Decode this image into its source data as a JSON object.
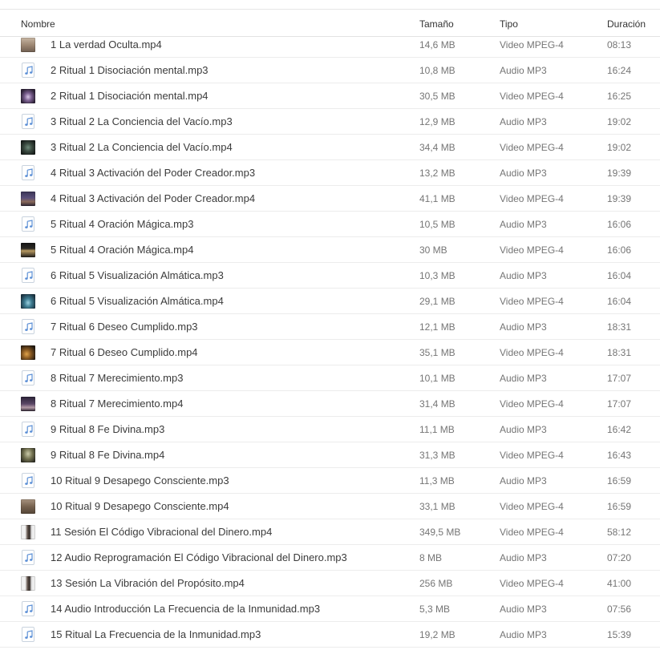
{
  "columns": {
    "name": "Nombre",
    "size": "Tamaño",
    "type": "Tipo",
    "duration": "Duración"
  },
  "files": [
    {
      "name": "1 La verdad Oculta.mp4",
      "size": "14,6 MB",
      "type": "Video MPEG-4",
      "duration": "08:13",
      "icon": "video-thumbnail-icon"
    },
    {
      "name": "2 Ritual 1 Disociación mental.mp3",
      "size": "10,8 MB",
      "type": "Audio MP3",
      "duration": "16:24",
      "icon": "audio-file-icon"
    },
    {
      "name": "2 Ritual 1 Disociación mental.mp4",
      "size": "30,5 MB",
      "type": "Video MPEG-4",
      "duration": "16:25",
      "icon": "video-thumbnail-icon"
    },
    {
      "name": "3 Ritual 2 La Conciencia del Vacío.mp3",
      "size": "12,9 MB",
      "type": "Audio MP3",
      "duration": "19:02",
      "icon": "audio-file-icon"
    },
    {
      "name": "3 Ritual 2 La Conciencia del Vacío.mp4",
      "size": "34,4 MB",
      "type": "Video MPEG-4",
      "duration": "19:02",
      "icon": "video-thumbnail-icon"
    },
    {
      "name": "4 Ritual 3 Activación del Poder Creador.mp3",
      "size": "13,2 MB",
      "type": "Audio MP3",
      "duration": "19:39",
      "icon": "audio-file-icon"
    },
    {
      "name": "4 Ritual 3 Activación del Poder Creador.mp4",
      "size": "41,1 MB",
      "type": "Video MPEG-4",
      "duration": "19:39",
      "icon": "video-thumbnail-icon"
    },
    {
      "name": "5 Ritual 4 Oración Mágica.mp3",
      "size": "10,5 MB",
      "type": "Audio MP3",
      "duration": "16:06",
      "icon": "audio-file-icon"
    },
    {
      "name": "5 Ritual 4 Oración Mágica.mp4",
      "size": "30 MB",
      "type": "Video MPEG-4",
      "duration": "16:06",
      "icon": "video-thumbnail-icon"
    },
    {
      "name": "6 Ritual 5 Visualización Almática.mp3",
      "size": "10,3 MB",
      "type": "Audio MP3",
      "duration": "16:04",
      "icon": "audio-file-icon"
    },
    {
      "name": "6 Ritual 5 Visualización Almática.mp4",
      "size": "29,1 MB",
      "type": "Video MPEG-4",
      "duration": "16:04",
      "icon": "video-thumbnail-icon"
    },
    {
      "name": "7 Ritual 6 Deseo Cumplido.mp3",
      "size": "12,1 MB",
      "type": "Audio MP3",
      "duration": "18:31",
      "icon": "audio-file-icon"
    },
    {
      "name": "7 Ritual 6 Deseo Cumplido.mp4",
      "size": "35,1 MB",
      "type": "Video MPEG-4",
      "duration": "18:31",
      "icon": "video-thumbnail-icon"
    },
    {
      "name": "8 Ritual 7 Merecimiento.mp3",
      "size": "10,1 MB",
      "type": "Audio MP3",
      "duration": "17:07",
      "icon": "audio-file-icon"
    },
    {
      "name": "8 Ritual 7 Merecimiento.mp4",
      "size": "31,4 MB",
      "type": "Video MPEG-4",
      "duration": "17:07",
      "icon": "video-thumbnail-icon"
    },
    {
      "name": "9 Ritual 8 Fe Divina.mp3",
      "size": "11,1 MB",
      "type": "Audio MP3",
      "duration": "16:42",
      "icon": "audio-file-icon"
    },
    {
      "name": "9 Ritual 8 Fe Divina.mp4",
      "size": "31,3 MB",
      "type": "Video MPEG-4",
      "duration": "16:43",
      "icon": "video-thumbnail-icon"
    },
    {
      "name": "10 Ritual 9 Desapego Consciente.mp3",
      "size": "11,3 MB",
      "type": "Audio MP3",
      "duration": "16:59",
      "icon": "audio-file-icon"
    },
    {
      "name": "10 Ritual 9 Desapego Consciente.mp4",
      "size": "33,1 MB",
      "type": "Video MPEG-4",
      "duration": "16:59",
      "icon": "video-thumbnail-icon"
    },
    {
      "name": "11 Sesión El Código Vibracional del Dinero.mp4",
      "size": "349,5 MB",
      "type": "Video MPEG-4",
      "duration": "58:12",
      "icon": "person-thumbnail-icon"
    },
    {
      "name": "12 Audio Reprogramación El Código Vibracional del Dinero.mp3",
      "size": "8 MB",
      "type": "Audio MP3",
      "duration": "07:20",
      "icon": "audio-file-icon"
    },
    {
      "name": "13 Sesión La Vibración del Propósito.mp4",
      "size": "256 MB",
      "type": "Video MPEG-4",
      "duration": "41:00",
      "icon": "person-thumbnail-icon"
    },
    {
      "name": "14 Audio Introducción La Frecuencia de la Inmunidad.mp3",
      "size": "5,3 MB",
      "type": "Audio MP3",
      "duration": "07:56",
      "icon": "audio-file-icon"
    },
    {
      "name": "15 Ritual La Frecuencia de la Inmunidad.mp3",
      "size": "19,2 MB",
      "type": "Audio MP3",
      "duration": "15:39",
      "icon": "audio-file-icon"
    }
  ],
  "colors": {
    "audio_icon": "#5b8fd6",
    "header_border": "#e3e3e3",
    "row_border": "#ececec"
  }
}
